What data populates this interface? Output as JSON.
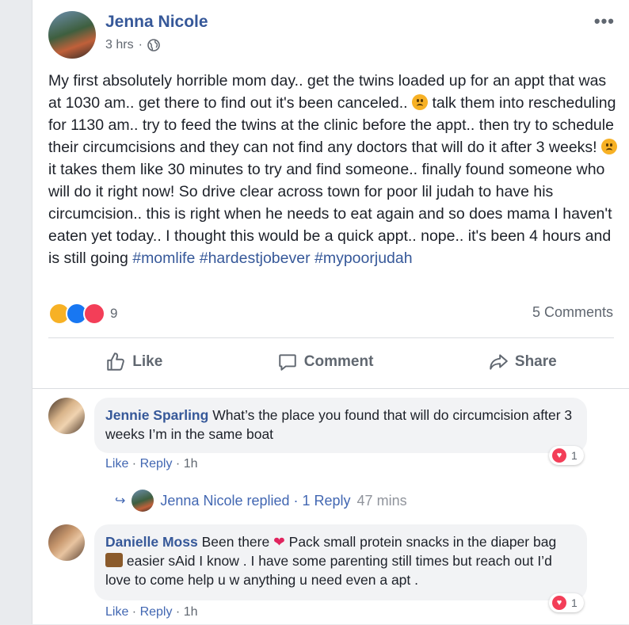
{
  "post": {
    "author": "Jenna Nicole",
    "time": "3 hrs",
    "privacy_icon": "globe-icon",
    "more_label": "•••",
    "text_segments": [
      "My first absolutely horrible mom day.. get the twins loaded up for an appt that was at 1030 am.. get there to find out it's been canceled..",
      "talk them into rescheduling for 1130 am.. try to feed the twins at the clinic before the appt.. then try to schedule their circumcisions and they can not find any doctors that will do it after 3 weeks!",
      "it takes them like 30 minutes to try and find someone.. finally found someone who will do it right now! So drive clear across town for poor lil judah to have his circumcision.. this is right when he needs to eat again and so does mama I haven't eaten yet today.. I thought this would be a quick appt.. nope.. it's been 4 hours and is still going"
    ],
    "hashtags": "#momlife #hardestjobever #mypoorjudah",
    "reaction_count": "9",
    "comments_count": "5 Comments"
  },
  "actions": {
    "like": "Like",
    "comment": "Comment",
    "share": "Share"
  },
  "comments": [
    {
      "name": "Jennie Sparling",
      "text": "What’s the place you found that will do circumcision after 3 weeks I’m in the same boat",
      "like": "Like",
      "reply": "Reply",
      "time": "1h",
      "reaction_count": "1"
    },
    {
      "name": "Danielle Moss",
      "text_a": "Been there",
      "text_b": "Pack small protein snacks in the diaper bag",
      "text_c": "easier sAid I know . I have some parenting still times but reach out I’d love to come help u w anything u need even a apt .",
      "like": "Like",
      "reply": "Reply",
      "time": "1h",
      "reaction_count": "1"
    }
  ],
  "reply_summary": {
    "text": "Jenna Nicole replied · 1 Reply",
    "time": "47 mins"
  },
  "colors": {
    "link": "#365899",
    "accent": "#4267b2",
    "love": "#f33e58"
  }
}
